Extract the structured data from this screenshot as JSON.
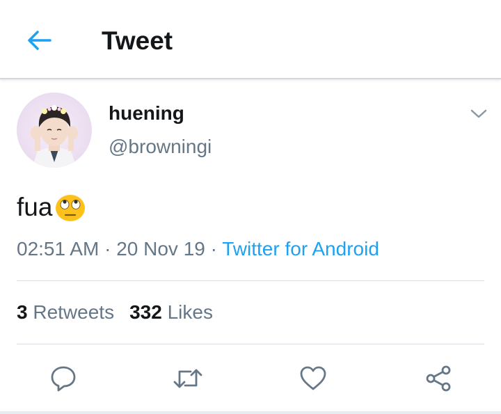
{
  "header": {
    "title": "Tweet",
    "back_icon": "arrow-left-icon"
  },
  "tweet": {
    "author": {
      "display_name": "huening",
      "handle": "@browningi"
    },
    "text": "fua",
    "emoji": "face-with-rolling-eyes-emoji",
    "time": "02:51 AM",
    "date": "20 Nov 19",
    "separator": "·",
    "source": "Twitter for Android",
    "stats": {
      "retweets_count": "3",
      "retweets_label": "Retweets",
      "likes_count": "332",
      "likes_label": "Likes"
    },
    "actions": [
      "reply-icon",
      "retweet-icon",
      "like-icon",
      "share-icon"
    ]
  },
  "colors": {
    "accent": "#1da1f2",
    "text_primary": "#14171a",
    "text_secondary": "#657786",
    "divider": "#d9dde1"
  }
}
